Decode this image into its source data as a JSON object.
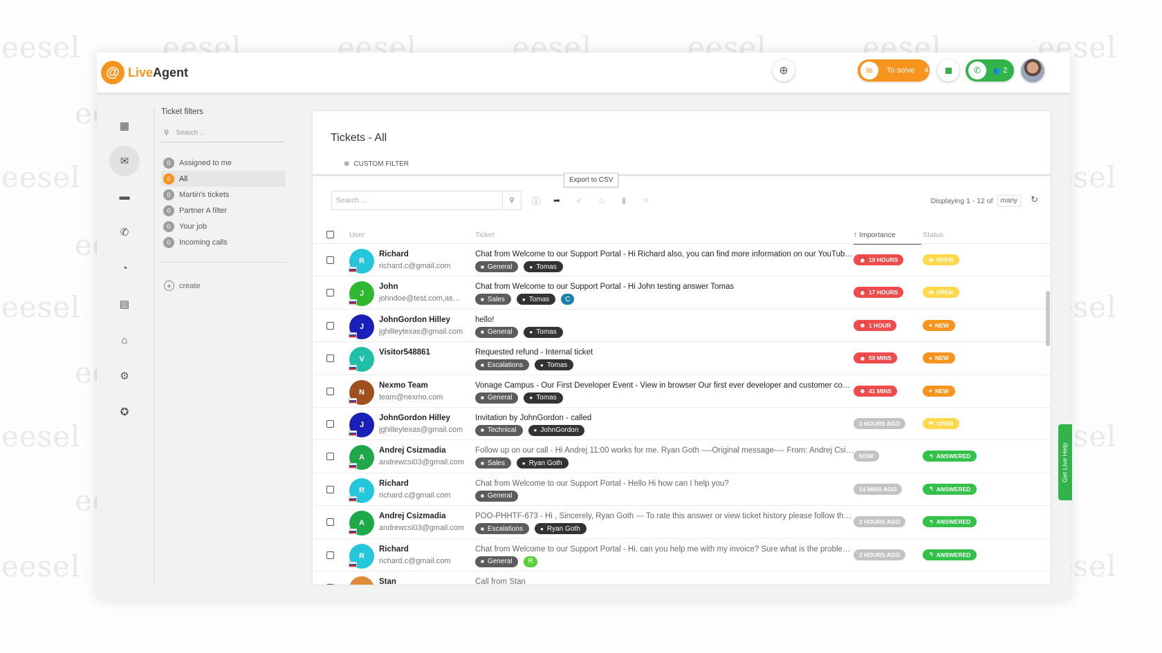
{
  "watermark": "eesel",
  "header": {
    "logo_text_a": "Live",
    "logo_text_b": "Agent",
    "to_solve_label": "To solve",
    "to_solve_count": "4",
    "call_count": "2"
  },
  "rail": [
    "dashboard-icon",
    "mail-icon",
    "chat-icon",
    "phone-icon",
    "reports-icon",
    "contacts-icon",
    "companies-icon",
    "settings-icon",
    "plugins-icon"
  ],
  "filters": {
    "title": "Ticket filters",
    "search_placeholder": "Search ..",
    "items": [
      {
        "label": "Assigned to me",
        "count": "0"
      },
      {
        "label": "All",
        "count": "6"
      },
      {
        "label": "Martin's tickets",
        "count": "0"
      },
      {
        "label": "Partner A filter",
        "count": "0"
      },
      {
        "label": "Your job",
        "count": "0"
      },
      {
        "label": "Incoming calls",
        "count": "0"
      }
    ],
    "create_label": "create"
  },
  "panel": {
    "title": "Tickets - All",
    "custom_filter": "CUSTOM FILTER",
    "search_placeholder": "Search ...",
    "tooltip": "Export to CSV",
    "displaying": "Displaying 1 - 12 of",
    "many": "many"
  },
  "columns": {
    "user": "User",
    "ticket": "Ticket",
    "importance": "Importance",
    "status": "Status"
  },
  "tickets": [
    {
      "initial": "R",
      "avatar_color": "#26c6da",
      "name": "Richard",
      "email": "richard.c@gmail.com",
      "subject": "Chat from Welcome to our Support Portal - Hi Richard also, you can find more information on our YouTube ...",
      "subject_style": "bold",
      "department": "General",
      "agent": "Tomas",
      "extra": "",
      "importance": "19 HOURS",
      "importance_style": "red",
      "status": "OPEN",
      "status_style": "open"
    },
    {
      "initial": "J",
      "avatar_color": "#2fb72f",
      "name": "John",
      "email": "johndoe@test.com,as@t...",
      "subject": "Chat from Welcome to our Support Portal - Hi John testing answer Tomas",
      "subject_style": "bold",
      "department": "Sales",
      "agent": "Tomas",
      "extra": "C",
      "extra_style": "blue",
      "importance": "17 HOURS",
      "importance_style": "red",
      "status": "OPEN",
      "status_style": "open"
    },
    {
      "initial": "J",
      "avatar_color": "#1a1fb8",
      "name": "JohnGordon Hilley",
      "email": "jghilleytexas@gmail.com",
      "subject": "hello!",
      "subject_style": "bold",
      "department": "General",
      "agent": "Tomas",
      "extra": "",
      "importance": "1 HOUR",
      "importance_style": "red",
      "status": "NEW",
      "status_style": "new"
    },
    {
      "initial": "V",
      "avatar_color": "#1fbfa8",
      "name": "Visitor548861",
      "email": "",
      "subject": "Requested refund - Internal ticket",
      "subject_style": "bold",
      "department": "Escalations",
      "agent": "Tomas",
      "extra": "",
      "importance": "59 MINS",
      "importance_style": "red",
      "status": "NEW",
      "status_style": "new"
    },
    {
      "initial": "N",
      "avatar_color": "#a0501e",
      "name": "Nexmo Team",
      "email": "team@nexmo.com",
      "subject": "Vonage Campus - Our First Developer Event - View in browser Our first ever developer and customer confer...",
      "subject_style": "bold",
      "department": "General",
      "agent": "Tomas",
      "extra": "",
      "importance": "41 MINS",
      "importance_style": "red",
      "status": "NEW",
      "status_style": "new"
    },
    {
      "initial": "J",
      "avatar_color": "#1a1fb8",
      "name": "JohnGordon Hilley",
      "email": "jghilleytexas@gmail.com",
      "subject": "Invitation by JohnGordon - called",
      "subject_style": "bold",
      "department": "Technical",
      "agent": "JohnGordon",
      "extra": "",
      "importance": "3 HOURS AGO",
      "importance_style": "grey",
      "status": "OPEN",
      "status_style": "open"
    },
    {
      "initial": "A",
      "avatar_color": "#1ea84a",
      "name": "Andrej Csizmadia",
      "email": "andrewcsi03@gmail.com",
      "subject": "Follow up on our call - Hi Andrej 11:00 works for me. Ryan Goth ----Original message---- From: Andrej Csizm...",
      "subject_style": "light",
      "department": "Sales",
      "agent": "Ryan Goth",
      "extra": "",
      "importance": "NOW",
      "importance_style": "grey",
      "status": "ANSWERED",
      "status_style": "answered"
    },
    {
      "initial": "R",
      "avatar_color": "#26c6da",
      "name": "Richard",
      "email": "richard.c@gmail.com",
      "subject": "Chat from Welcome to our Support Portal - Hello Hi how can I help you?",
      "subject_style": "light",
      "department": "General",
      "agent": "",
      "extra": "",
      "importance": "14 MINS AGO",
      "importance_style": "grey",
      "status": "ANSWERED",
      "status_style": "answered"
    },
    {
      "initial": "A",
      "avatar_color": "#1ea84a",
      "name": "Andrej Csizmadia",
      "email": "andrewcsi03@gmail.com",
      "subject": "POO-PHHTF-673 - Hi , Sincerely, Ryan Goth --- To rate this answer or view ticket history please follow the link: ...",
      "subject_style": "light",
      "department": "Escalations",
      "agent": "Ryan Goth",
      "extra": "",
      "importance": "2 HOURS AGO",
      "importance_style": "grey",
      "status": "ANSWERED",
      "status_style": "answered"
    },
    {
      "initial": "R",
      "avatar_color": "#26c6da",
      "name": "Richard",
      "email": "richard.c@gmail.com",
      "subject": "Chat from Welcome to our Support Portal - Hi, can you help me with my invoice? Sure what is the problem? I ...",
      "subject_style": "light",
      "department": "General",
      "agent": "",
      "extra": "R",
      "extra_style": "green",
      "importance": "2 HOURS AGO",
      "importance_style": "grey",
      "status": "ANSWERED",
      "status_style": "answered"
    },
    {
      "initial": "S",
      "avatar_color": "#e08a3c",
      "name": "Stan",
      "email": "",
      "subject": "Call from Stan",
      "subject_style": "light",
      "department": "",
      "agent": "",
      "extra": "",
      "importance": "",
      "importance_style": "grey",
      "status": "",
      "status_style": "answered"
    }
  ],
  "live_help": "Get Live Help",
  "colors": {
    "accent": "#f7941d",
    "green": "#33b44a",
    "red": "#f04b4b"
  }
}
